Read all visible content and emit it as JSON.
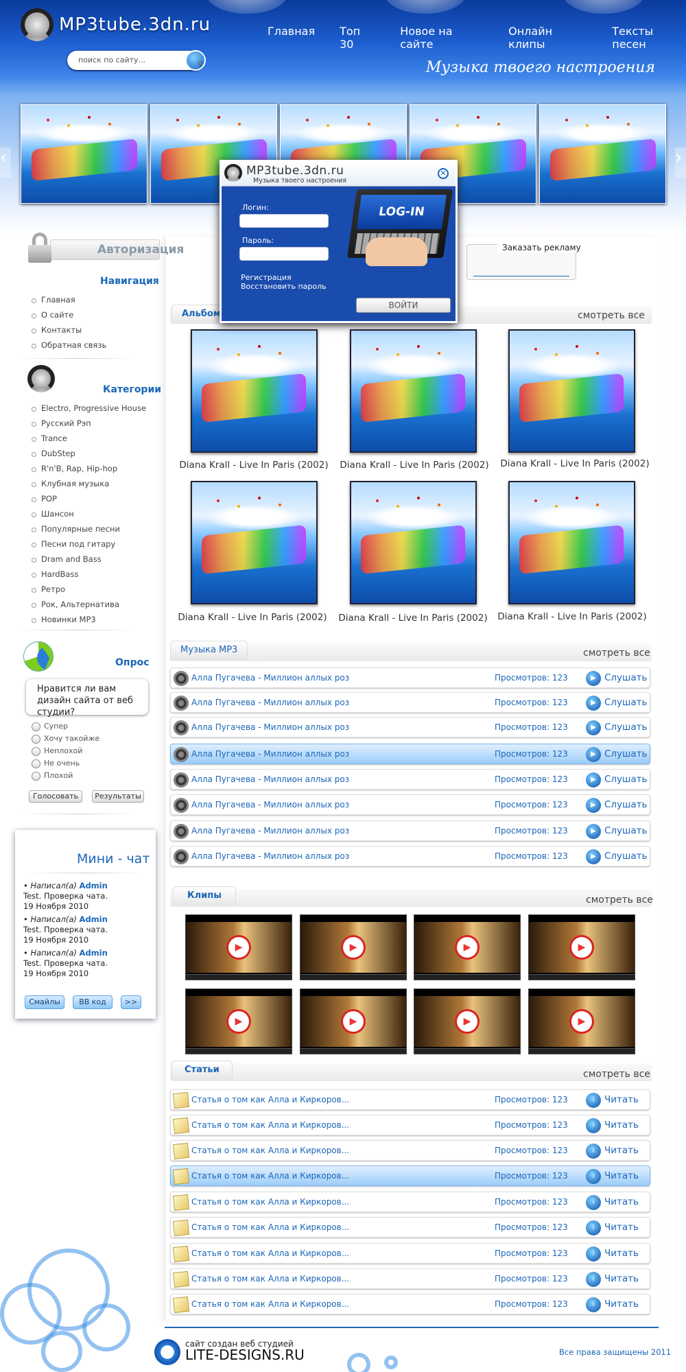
{
  "header": {
    "logo_text": "MP3tube.3dn.ru",
    "nav": [
      "Главная",
      "Топ 30",
      "Новое на сайте",
      "Онлайн клипы",
      "Тексты песен"
    ],
    "search_placeholder": "поиск по сайту...",
    "slogan": "Музыка твоего настроения"
  },
  "sidebar": {
    "auth_title": "Авторизация",
    "nav_title": "Навигация",
    "nav_items": [
      "Главная",
      "О сайте",
      "Контакты",
      "Обратная связь"
    ],
    "cat_title": "Категории",
    "categories": [
      "Electro, Progressive House",
      "Русский Рэп",
      "Trance",
      "DubStep",
      "R'n'B, Rap, Hip-hop",
      "Клубная музыка",
      "POP",
      "Шансон",
      "Популярные песни",
      "Песни под гитару",
      "Dram and Bass",
      "HardBass",
      "Ретро",
      "Рок, Альтернатива",
      "Новинки MP3"
    ],
    "poll_title": "Опрос",
    "poll_question": "Нравится ли вам дизайн сайта от веб студии?",
    "poll_options": [
      "Супер",
      "Хочу такойже",
      "Неплохой",
      "Не очень",
      "Плохой"
    ],
    "vote_button": "Голосовать",
    "results_button": "Результаты",
    "chat_title": "Мини - чат",
    "chat_messages": [
      {
        "prefix": "Написал(а)",
        "author": "Admin",
        "text": "Test. Проверка чата.",
        "date": "19 Ноября 2010"
      },
      {
        "prefix": "Написал(а)",
        "author": "Admin",
        "text": "Test. Проверка чата.",
        "date": "19 Ноября 2010"
      },
      {
        "prefix": "Написал(а)",
        "author": "Admin",
        "text": "Test. Проверка чата.",
        "date": "19 Ноября 2010"
      }
    ],
    "chat_buttons": [
      "Смайлы",
      "BB код",
      ">>"
    ]
  },
  "login_modal": {
    "logo": "MP3tube.3dn.ru",
    "subtitle": "Музыка твоего настроения",
    "login_label": "Логин:",
    "password_label": "Пароль:",
    "register_link": "Регистрация",
    "restore_link": "Восстановить пароль",
    "submit": "ВОЙТИ",
    "screen_text": "LOG-IN"
  },
  "ad": {
    "label": "Заказать рекламу"
  },
  "albums": {
    "tab": "Альбомы",
    "see_all": "смотреть все",
    "items": [
      "Diana Krall - Live In Paris (2002)",
      "Diana Krall - Live In Paris (2002)",
      "Diana Krall - Live In Paris (2002)",
      "Diana Krall - Live In Paris (2002)",
      "Diana Krall - Live In Paris (2002)",
      "Diana Krall - Live In Paris (2002)"
    ]
  },
  "music": {
    "tab": "Музыка MP3",
    "see_all": "смотреть все",
    "action": "Слушать",
    "rows": [
      {
        "title": "Алла Пугачева - Миллион аллых роз",
        "views": "Просмотров: 123"
      },
      {
        "title": "Алла Пугачева - Миллион аллых роз",
        "views": "Просмотров: 123"
      },
      {
        "title": "Алла Пугачева - Миллион аллых роз",
        "views": "Просмотров: 123"
      },
      {
        "title": "Алла Пугачева - Миллион аллых роз",
        "views": "Просмотров: 123"
      },
      {
        "title": "Алла Пугачева - Миллион аллых роз",
        "views": "Просмотров: 123"
      },
      {
        "title": "Алла Пугачева - Миллион аллых роз",
        "views": "Просмотров: 123"
      },
      {
        "title": "Алла Пугачева - Миллион аллых роз",
        "views": "Просмотров: 123"
      },
      {
        "title": "Алла Пугачева - Миллион аллых роз",
        "views": "Просмотров: 123"
      }
    ]
  },
  "clips": {
    "tab": "Клипы",
    "see_all": "смотреть все"
  },
  "articles": {
    "tab": "Статьи",
    "see_all": "смотреть все",
    "action": "Читать",
    "rows": [
      {
        "title": "Статья о том как Алла и Киркоров...",
        "views": "Просмотров: 123"
      },
      {
        "title": "Статья о том как Алла и Киркоров...",
        "views": "Просмотров: 123"
      },
      {
        "title": "Статья о том как Алла и Киркоров...",
        "views": "Просмотров: 123"
      },
      {
        "title": "Статья о том как Алла и Киркоров...",
        "views": "Просмотров: 123"
      },
      {
        "title": "Статья о том как Алла и Киркоров...",
        "views": "Просмотров: 123"
      },
      {
        "title": "Статья о том как Алла и Киркоров...",
        "views": "Просмотров: 123"
      },
      {
        "title": "Статья о том как Алла и Киркоров...",
        "views": "Просмотров: 123"
      },
      {
        "title": "Статья о том как Алла и Киркоров...",
        "views": "Просмотров: 123"
      },
      {
        "title": "Статья о том как Алла и Киркоров...",
        "views": "Просмотров: 123"
      }
    ]
  },
  "footer": {
    "studio_line": "сайт создан веб студией",
    "studio_name": "LITE-DESIGNS.RU",
    "rights": "Все права защищены 2011"
  },
  "colors": {
    "brand_blue": "#1a66b8",
    "header_blue": "#1d5fd0"
  }
}
